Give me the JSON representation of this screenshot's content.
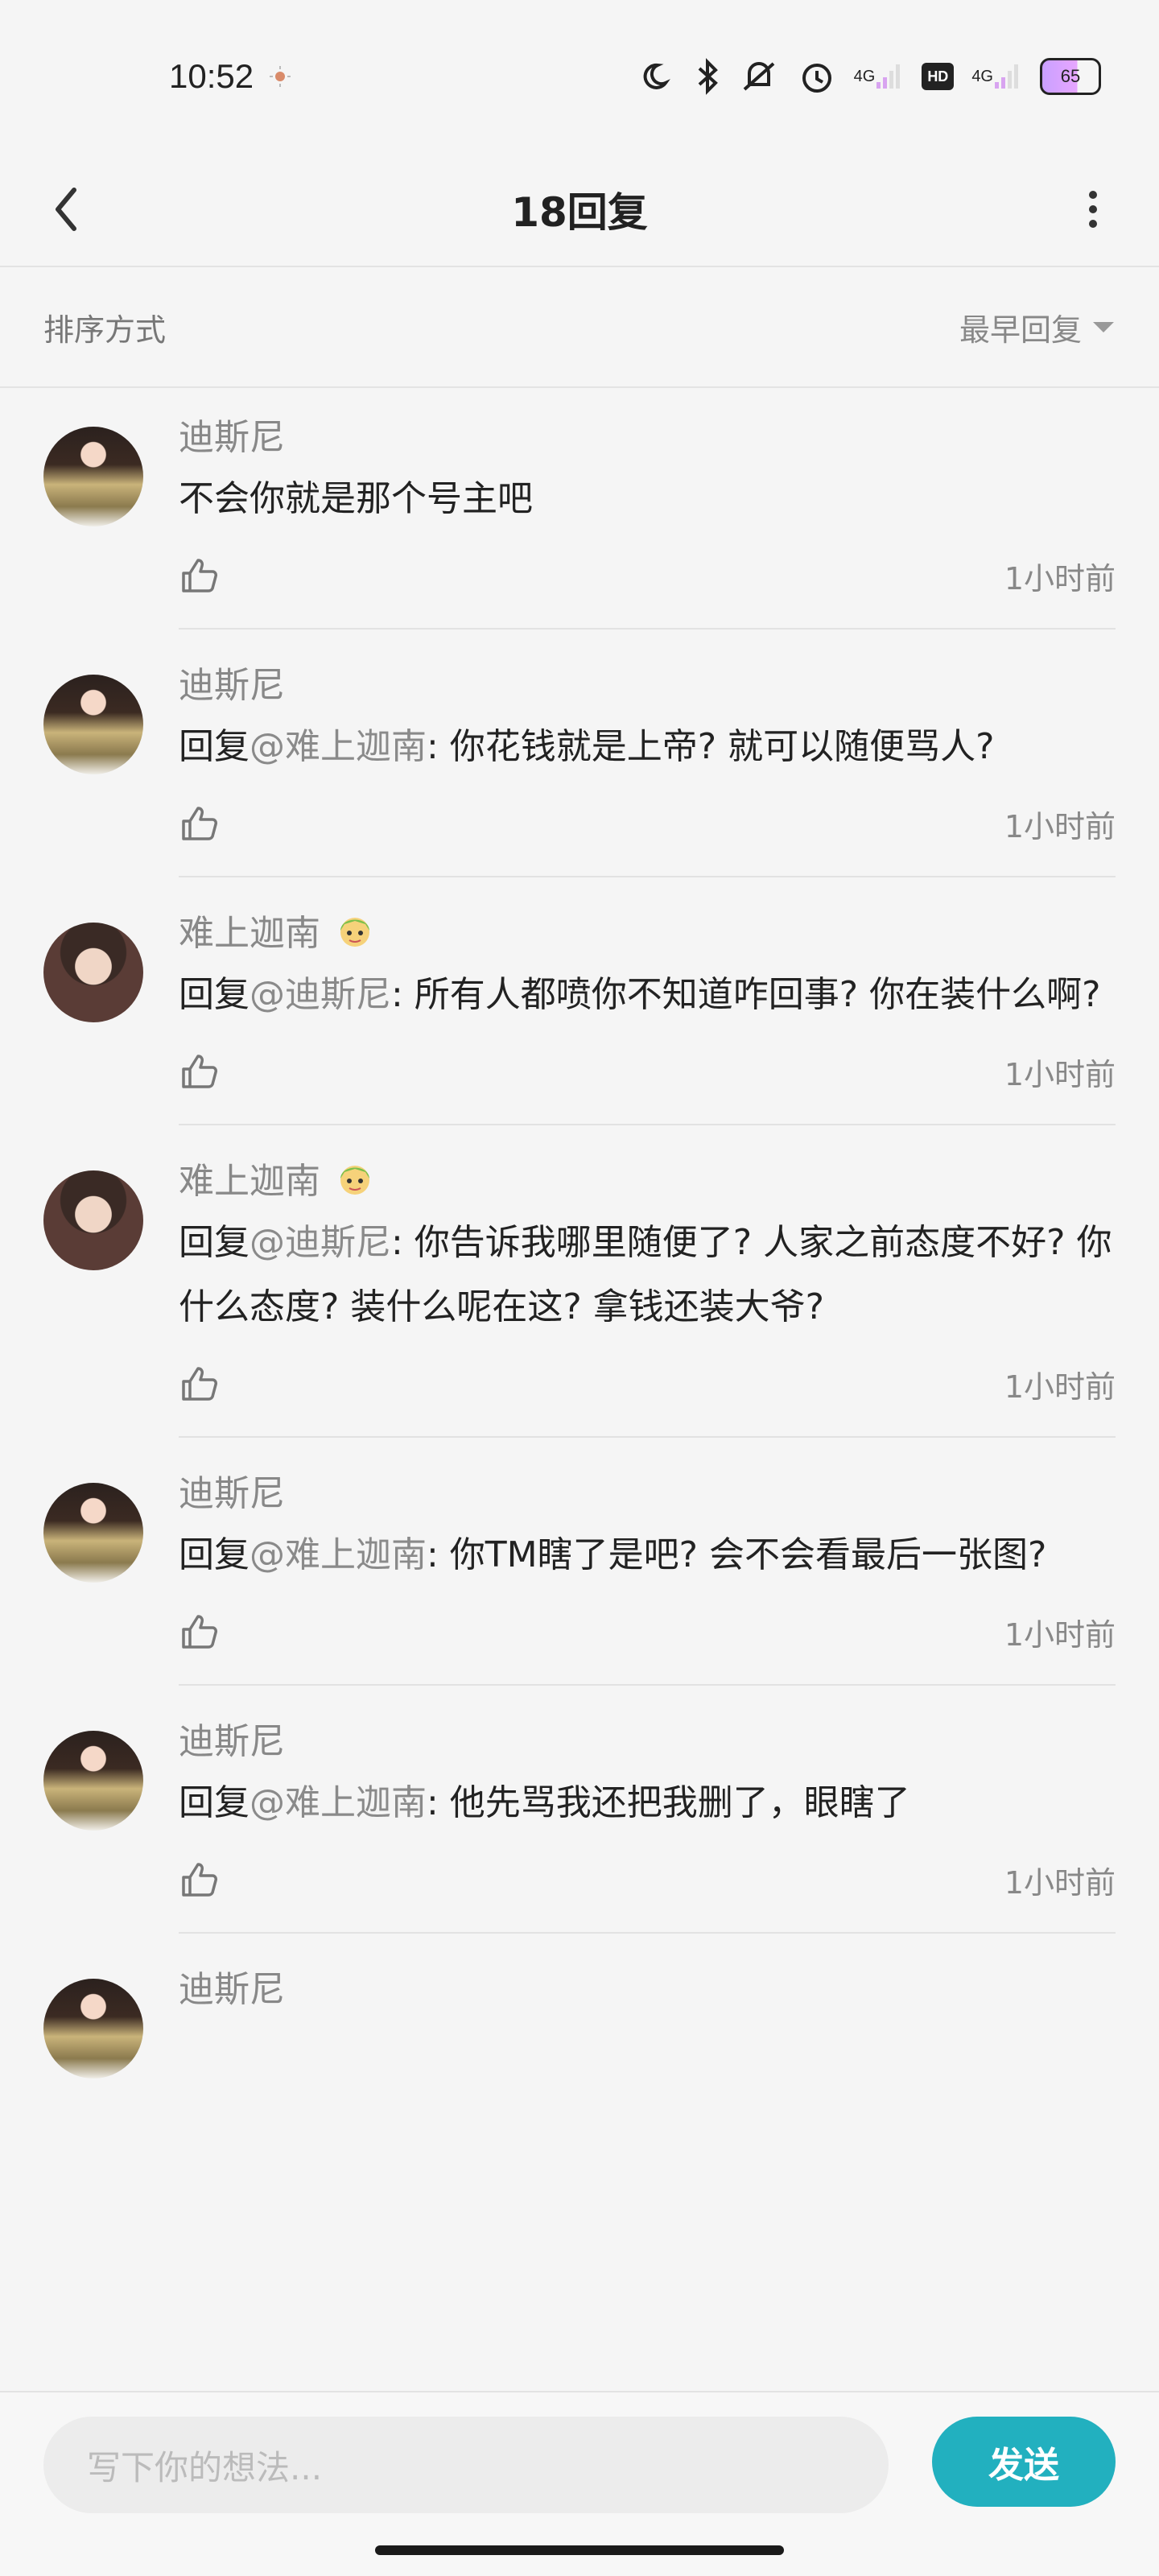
{
  "status_bar": {
    "time": "10:52",
    "net_label_1": "4G",
    "net_label_2": "4G",
    "hd_label": "HD",
    "battery": "65",
    "icons": [
      "moon-icon",
      "bluetooth-icon",
      "mute-icon",
      "alarm-icon",
      "signal-icon",
      "signal-icon"
    ]
  },
  "nav": {
    "title": "18回复",
    "back_icon": "chevron-left-icon",
    "more_icon": "more-vertical-icon"
  },
  "sort": {
    "label": "排序方式",
    "value": "最早回复"
  },
  "comments": [
    {
      "user": "迪斯尼",
      "avatar": "disney",
      "reply_prefix": "",
      "mention": "",
      "text": "不会你就是那个号主吧",
      "time": "1小时前"
    },
    {
      "user": "迪斯尼",
      "avatar": "disney",
      "reply_prefix": "回复",
      "mention": "@难上迦南",
      "text": ": 你花钱就是上帝? 就可以随便骂人?",
      "time": "1小时前"
    },
    {
      "user": "难上迦南",
      "avatar": "nan",
      "badge": true,
      "reply_prefix": "回复",
      "mention": "@迪斯尼",
      "text": ": 所有人都喷你不知道咋回事? 你在装什么啊?",
      "time": "1小时前"
    },
    {
      "user": "难上迦南",
      "avatar": "nan",
      "badge": true,
      "reply_prefix": "回复",
      "mention": "@迪斯尼",
      "text": ": 你告诉我哪里随便了? 人家之前态度不好? 你什么态度? 装什么呢在这? 拿钱还装大爷?",
      "time": "1小时前"
    },
    {
      "user": "迪斯尼",
      "avatar": "disney",
      "reply_prefix": "回复",
      "mention": "@难上迦南",
      "text": ": 你TM瞎了是吧? 会不会看最后一张图?",
      "time": "1小时前"
    },
    {
      "user": "迪斯尼",
      "avatar": "disney",
      "reply_prefix": "回复",
      "mention": "@难上迦南",
      "text": ": 他先骂我还把我删了，眼瞎了",
      "time": "1小时前"
    },
    {
      "user": "迪斯尼",
      "avatar": "disney",
      "partial": true
    }
  ],
  "input": {
    "placeholder": "写下你的想法...",
    "send_label": "发送"
  },
  "colors": {
    "accent": "#22b0bf",
    "background": "#f5f5f5",
    "mention": "#8a8a8a"
  }
}
